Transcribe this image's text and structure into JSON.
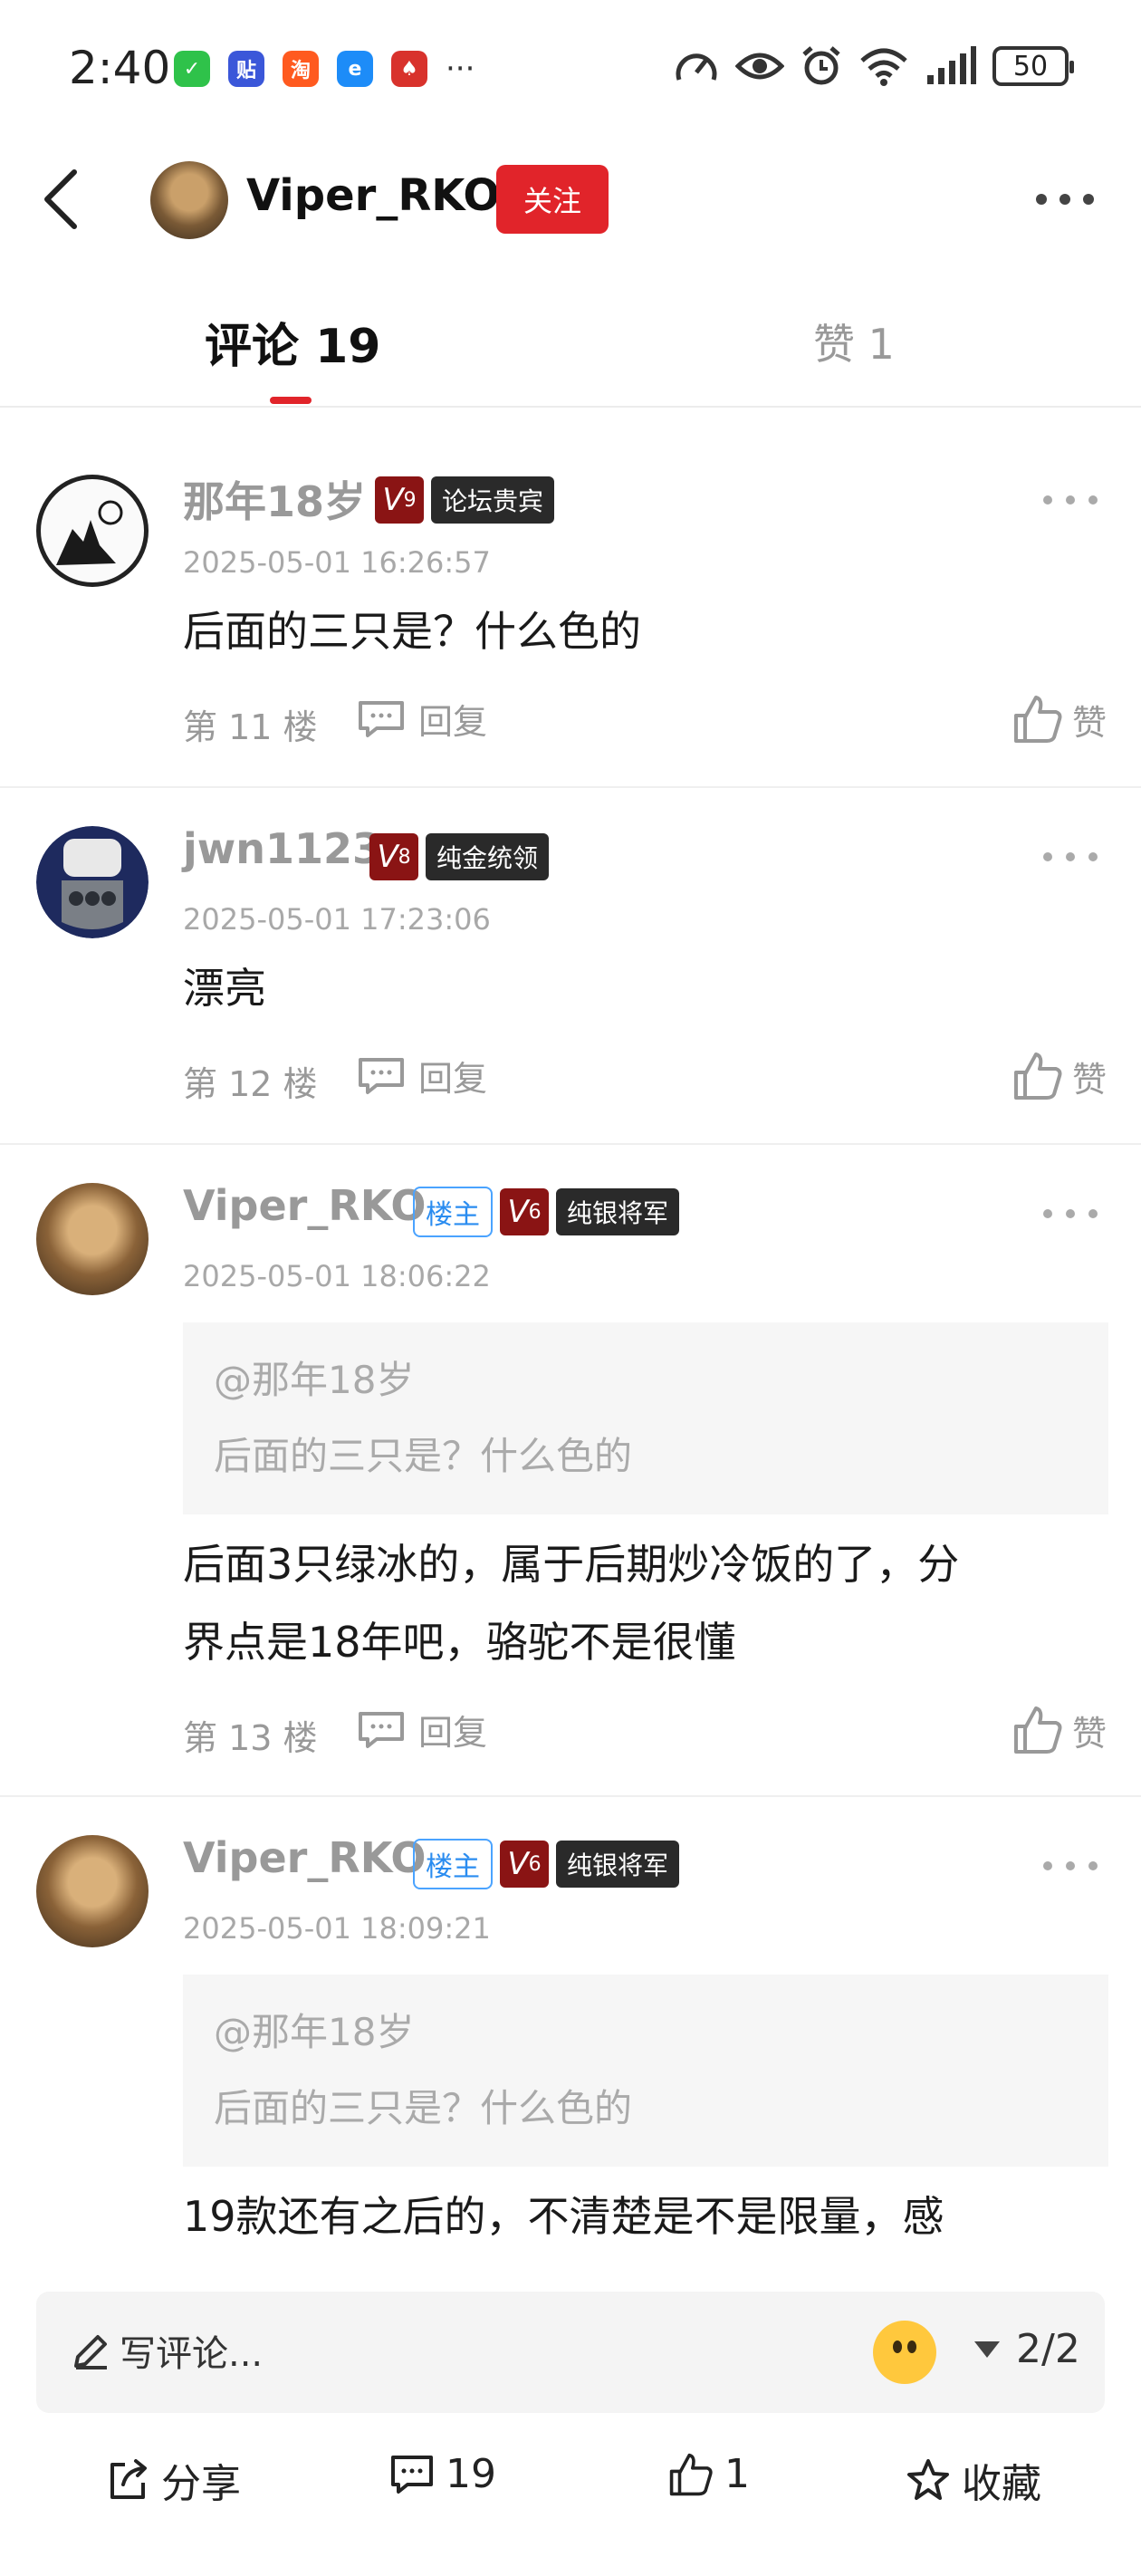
{
  "status_bar": {
    "time": "2:40",
    "apps": [
      {
        "icon": "wechat-icon",
        "glyph": "✓",
        "color": "#2fc24a"
      },
      {
        "icon": "tieba-icon",
        "glyph": "贴",
        "color": "#3b57d9"
      },
      {
        "icon": "taobao-icon",
        "glyph": "淘",
        "color": "#ff5a1f"
      },
      {
        "icon": "eleme-icon",
        "glyph": "e",
        "color": "#1d8cf8"
      },
      {
        "icon": "card-game-icon",
        "glyph": "♠",
        "color": "#d8322c"
      }
    ],
    "more": "···",
    "battery": "50"
  },
  "header": {
    "username": "Viper_RKO",
    "follow_label": "关注"
  },
  "tabs": {
    "comments_label": "评论 19",
    "likes_label": "赞 1"
  },
  "comments": [
    {
      "name": "那年18岁",
      "level": "V",
      "level_num": "9",
      "title": "论坛贵宾",
      "time": "2025-05-01 16:26:57",
      "text": "后面的三只是？什么色的",
      "floor": "第 11 楼",
      "reply_label": "回复",
      "like_label": "赞"
    },
    {
      "name": "jwn1123",
      "level": "V",
      "level_num": "8",
      "title": "纯金统领",
      "time": "2025-05-01 17:23:06",
      "text": "漂亮",
      "floor": "第 12 楼",
      "reply_label": "回复",
      "like_label": "赞"
    },
    {
      "name": "Viper_RKO",
      "op_label": "楼主",
      "level": "V",
      "level_num": "6",
      "title": "纯银将军",
      "time": "2025-05-01 18:06:22",
      "quote_user": "@那年18岁",
      "quote_text": "后面的三只是？什么色的",
      "text_line1": "后面3只绿冰的，属于后期炒冷饭的了，分",
      "text_line2": "界点是18年吧，骆驼不是很懂",
      "floor": "第 13 楼",
      "reply_label": "回复",
      "like_label": "赞"
    },
    {
      "name": "Viper_RKO",
      "op_label": "楼主",
      "level": "V",
      "level_num": "6",
      "title": "纯银将军",
      "time": "2025-05-01 18:09:21",
      "quote_user": "@那年18岁",
      "quote_text": "后面的三只是？什么色的",
      "text": "19款还有之后的，不清楚是不是限量，感"
    }
  ],
  "input_bar": {
    "placeholder": "写评论...",
    "page": "2/2"
  },
  "action_bar": {
    "share_label": "分享",
    "comment_count": "19",
    "like_count": "1",
    "favorite_label": "收藏"
  },
  "colors": {
    "accent_red": "#e1242a",
    "level_badge": "#8a1414",
    "title_badge": "#2a2a2a",
    "op_badge": "#2a8cf0"
  }
}
